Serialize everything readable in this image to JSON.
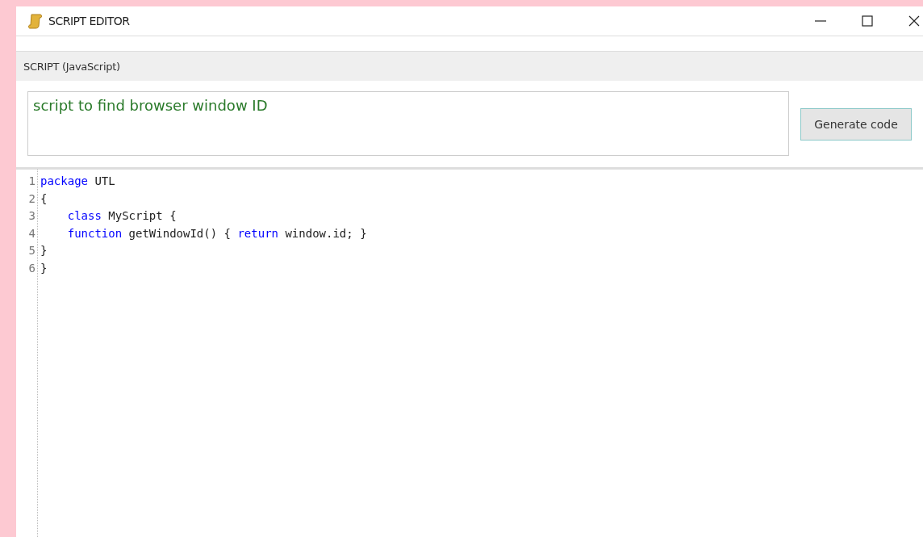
{
  "window": {
    "title": "SCRIPT EDITOR"
  },
  "panel": {
    "title": "SCRIPT (JavaScript)"
  },
  "prompt": {
    "value": "script to find browser window ID"
  },
  "generate_button": {
    "label": "Generate code"
  },
  "code_lines": [
    {
      "number": "1",
      "indented": false,
      "tokens": [
        {
          "text": "package",
          "kind": "keyword"
        },
        {
          "text": " UTL",
          "kind": "plain"
        }
      ]
    },
    {
      "number": "2",
      "indented": false,
      "tokens": [
        {
          "text": "{",
          "kind": "plain"
        }
      ]
    },
    {
      "number": "3",
      "indented": true,
      "tokens": [
        {
          "text": "class",
          "kind": "keyword"
        },
        {
          "text": " MyScript {",
          "kind": "plain"
        }
      ]
    },
    {
      "number": "4",
      "indented": true,
      "tokens": [
        {
          "text": "function",
          "kind": "keyword"
        },
        {
          "text": " getWindowId() { ",
          "kind": "plain"
        },
        {
          "text": "return",
          "kind": "keyword"
        },
        {
          "text": " window.id; }",
          "kind": "plain"
        }
      ]
    },
    {
      "number": "5",
      "indented": false,
      "tokens": [
        {
          "text": "}",
          "kind": "plain"
        }
      ]
    },
    {
      "number": "6",
      "indented": false,
      "tokens": [
        {
          "text": "}",
          "kind": "plain"
        }
      ]
    }
  ]
}
